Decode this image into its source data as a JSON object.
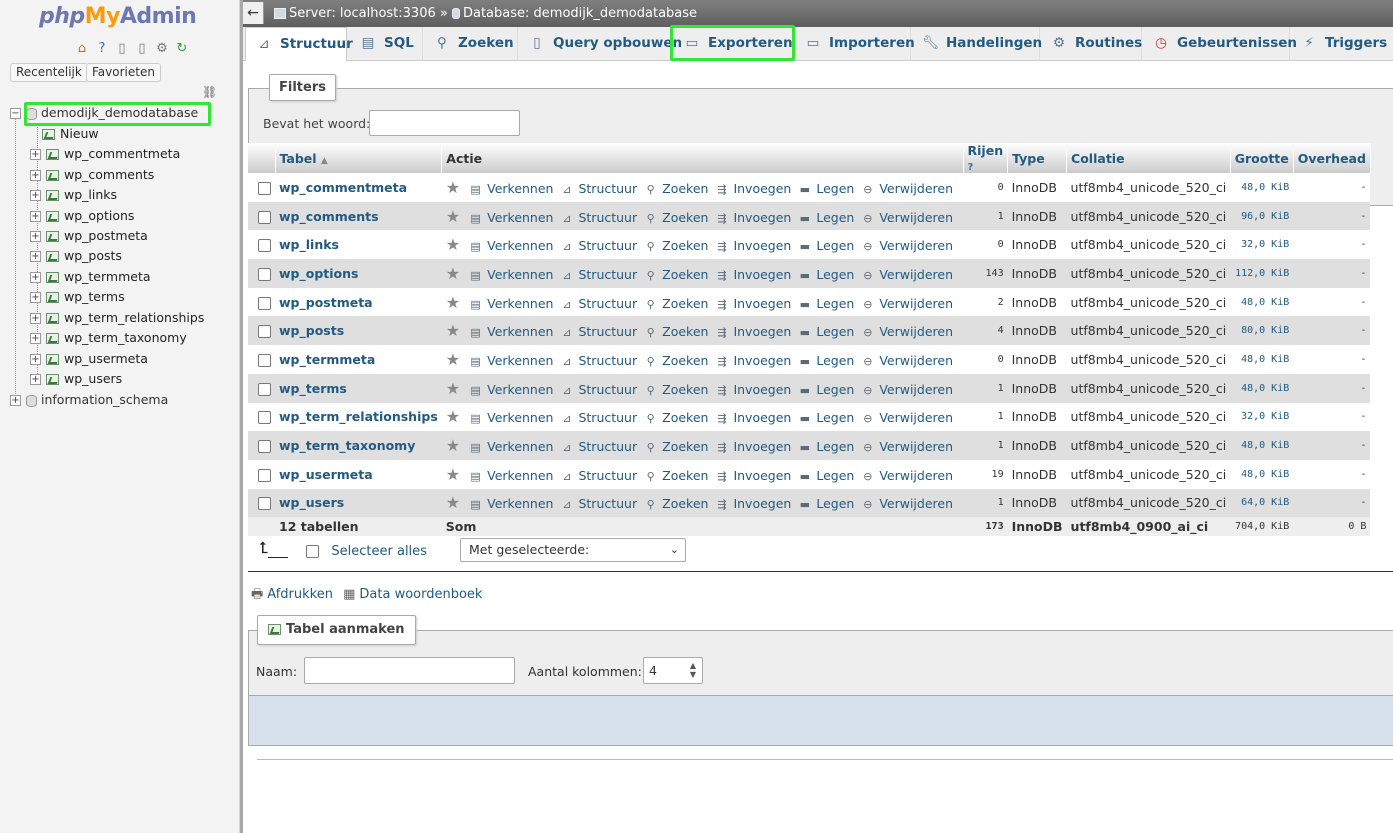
{
  "logo": {
    "php": "php",
    "my": "My",
    "admin": "Admin"
  },
  "nav_tabs": {
    "recent": "Recentelijk",
    "favorites": "Favorieten"
  },
  "tree": {
    "database": "demodijk_demodatabase",
    "new_label": "Nieuw",
    "tables": [
      "wp_commentmeta",
      "wp_comments",
      "wp_links",
      "wp_options",
      "wp_postmeta",
      "wp_posts",
      "wp_termmeta",
      "wp_terms",
      "wp_term_relationships",
      "wp_term_taxonomy",
      "wp_usermeta",
      "wp_users"
    ],
    "other_db": "information_schema"
  },
  "breadcrumb": {
    "server": "Server: localhost:3306",
    "sep": "»",
    "database": "Database: demodijk_demodatabase"
  },
  "tabs": [
    "Structuur",
    "SQL",
    "Zoeken",
    "Query opbouwen",
    "Exporteren",
    "Importeren",
    "Handelingen",
    "Routines",
    "Gebeurtenissen",
    "Triggers"
  ],
  "filters": {
    "legend": "Filters",
    "label": "Bevat het woord:",
    "value": ""
  },
  "table_headers": {
    "tabel": "Tabel",
    "actie": "Actie",
    "rijen": "Rijen",
    "type": "Type",
    "collatie": "Collatie",
    "grootte": "Grootte",
    "overhead": "Overhead"
  },
  "actions": {
    "browse": "Verkennen",
    "structure": "Structuur",
    "search": "Zoeken",
    "insert": "Invoegen",
    "empty": "Legen",
    "drop": "Verwijderen"
  },
  "rows": [
    {
      "name": "wp_commentmeta",
      "rows": "0",
      "type": "InnoDB",
      "collation": "utf8mb4_unicode_520_ci",
      "size": "48,0 KiB",
      "overhead": "-"
    },
    {
      "name": "wp_comments",
      "rows": "1",
      "type": "InnoDB",
      "collation": "utf8mb4_unicode_520_ci",
      "size": "96,0 KiB",
      "overhead": "-"
    },
    {
      "name": "wp_links",
      "rows": "0",
      "type": "InnoDB",
      "collation": "utf8mb4_unicode_520_ci",
      "size": "32,0 KiB",
      "overhead": "-"
    },
    {
      "name": "wp_options",
      "rows": "143",
      "type": "InnoDB",
      "collation": "utf8mb4_unicode_520_ci",
      "size": "112,0 KiB",
      "overhead": "-"
    },
    {
      "name": "wp_postmeta",
      "rows": "2",
      "type": "InnoDB",
      "collation": "utf8mb4_unicode_520_ci",
      "size": "48,0 KiB",
      "overhead": "-"
    },
    {
      "name": "wp_posts",
      "rows": "4",
      "type": "InnoDB",
      "collation": "utf8mb4_unicode_520_ci",
      "size": "80,0 KiB",
      "overhead": "-"
    },
    {
      "name": "wp_termmeta",
      "rows": "0",
      "type": "InnoDB",
      "collation": "utf8mb4_unicode_520_ci",
      "size": "48,0 KiB",
      "overhead": "-"
    },
    {
      "name": "wp_terms",
      "rows": "1",
      "type": "InnoDB",
      "collation": "utf8mb4_unicode_520_ci",
      "size": "48,0 KiB",
      "overhead": "-"
    },
    {
      "name": "wp_term_relationships",
      "rows": "1",
      "type": "InnoDB",
      "collation": "utf8mb4_unicode_520_ci",
      "size": "32,0 KiB",
      "overhead": "-"
    },
    {
      "name": "wp_term_taxonomy",
      "rows": "1",
      "type": "InnoDB",
      "collation": "utf8mb4_unicode_520_ci",
      "size": "48,0 KiB",
      "overhead": "-"
    },
    {
      "name": "wp_usermeta",
      "rows": "19",
      "type": "InnoDB",
      "collation": "utf8mb4_unicode_520_ci",
      "size": "48,0 KiB",
      "overhead": "-"
    },
    {
      "name": "wp_users",
      "rows": "1",
      "type": "InnoDB",
      "collation": "utf8mb4_unicode_520_ci",
      "size": "64,0 KiB",
      "overhead": "-"
    }
  ],
  "summary": {
    "count": "12 tabellen",
    "label": "Som",
    "rows": "173",
    "type": "InnoDB",
    "collation": "utf8mb4_0900_ai_ci",
    "size": "704,0 KiB",
    "overhead": "0 B"
  },
  "bulk": {
    "check_all": "Selecteer alles",
    "with_selected": "Met geselecteerde:"
  },
  "links": {
    "print": "Afdrukken",
    "dictionary": "Data woordenboek"
  },
  "create": {
    "legend": "Tabel aanmaken",
    "name_label": "Naam:",
    "name_value": "",
    "cols_label": "Aantal kolommen:",
    "cols_value": "4"
  },
  "colors": {
    "link": "#235a81",
    "highlight": "#33e633",
    "even_row": "#dfdfdf"
  }
}
